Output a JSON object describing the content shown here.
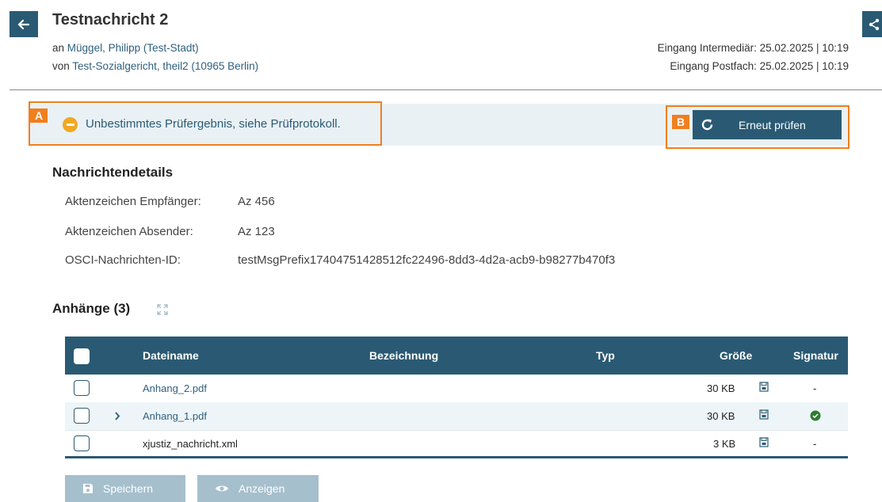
{
  "header": {
    "title": "Testnachricht 2",
    "to_prefix": "an",
    "to_value": "Müggel, Philipp (Test-Stadt)",
    "from_prefix": "von",
    "from_value": "Test-Sozialgericht, theil2 (10965 Berlin)",
    "received_intermediary": "Eingang Intermediär: 25.02.2025 | 10:19",
    "received_mailbox": "Eingang Postfach: 25.02.2025 | 10:19"
  },
  "banner": {
    "tag_a": "A",
    "tag_b": "B",
    "message": "Unbestimmtes Prüfergebnis, siehe Prüfprotokoll.",
    "recheck_label": "Erneut prüfen"
  },
  "details": {
    "heading": "Nachrichtendetails",
    "rows": [
      {
        "label": "Aktenzeichen Empfänger:",
        "value": "Az 456"
      },
      {
        "label": "Aktenzeichen Absender:",
        "value": "Az 123"
      },
      {
        "label": "OSCI-Nachrichten-ID:",
        "value": "testMsgPrefix17404751428512fc22496-8dd3-4d2a-acb9-b98277b470f3"
      }
    ]
  },
  "attachments": {
    "heading": "Anhänge (3)",
    "columns": {
      "filename": "Dateiname",
      "description": "Bezeichnung",
      "type": "Typ",
      "size": "Größe",
      "signature": "Signatur"
    },
    "rows": [
      {
        "filename": "Anhang_2.pdf",
        "size": "30 KB",
        "signature": "-"
      },
      {
        "filename": "Anhang_1.pdf",
        "size": "30 KB",
        "signature": "valid"
      },
      {
        "filename": "xjustiz_nachricht.xml",
        "size": "3 KB",
        "signature": "-"
      }
    ]
  },
  "actions": {
    "save_label": "Speichern",
    "view_label": "Anzeigen"
  },
  "colors": {
    "primary": "#2a5a73",
    "highlight": "#f07f1e",
    "warning": "#f0a823",
    "success": "#2e7d32"
  }
}
